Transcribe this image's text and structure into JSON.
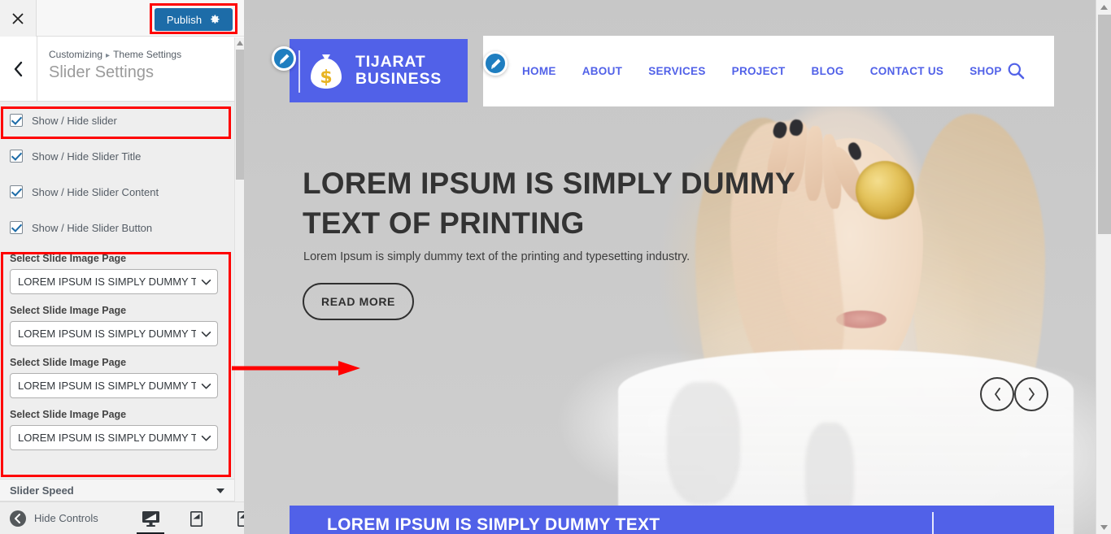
{
  "customizer": {
    "close_icon": "close-icon",
    "publish_label": "Publish",
    "publish_gear_icon": "gear-icon",
    "back_icon": "chevron-left-icon",
    "breadcrumb_root": "Customizing",
    "breadcrumb_separator": "▸",
    "breadcrumb_parent": "Theme Settings",
    "panel_title": "Slider Settings",
    "checkboxes": [
      {
        "label": "Show / Hide slider",
        "checked": true
      },
      {
        "label": "Show / Hide Slider Title",
        "checked": true
      },
      {
        "label": "Show / Hide Slider Content",
        "checked": true
      },
      {
        "label": "Show / Hide Slider Button",
        "checked": true
      }
    ],
    "selects": [
      {
        "label": "Select Slide Image Page",
        "value": "LOREM IPSUM IS SIMPLY DUMMY TE"
      },
      {
        "label": "Select Slide Image Page",
        "value": "LOREM IPSUM IS SIMPLY DUMMY TE"
      },
      {
        "label": "Select Slide Image Page",
        "value": "LOREM IPSUM IS SIMPLY DUMMY TE"
      },
      {
        "label": "Select Slide Image Page",
        "value": "LOREM IPSUM IS SIMPLY DUMMY TE"
      }
    ],
    "accordion": {
      "label": "Slider Speed",
      "caret_icon": "caret-down-icon"
    },
    "footer": {
      "hide_controls_label": "Hide Controls",
      "collapse_icon": "collapse-left-icon",
      "devices": [
        {
          "name": "desktop-preview",
          "icon": "desktop-icon",
          "active": true
        },
        {
          "name": "tablet-preview",
          "icon": "tablet-icon",
          "active": false
        },
        {
          "name": "mobile-preview",
          "icon": "mobile-icon",
          "active": false
        }
      ]
    },
    "annotations": {
      "accent_color": "#ff0000",
      "boxes": [
        "publish-button",
        "show-hide-slider-row",
        "select-slide-image-page-group"
      ],
      "arrow": "points-right-from-selects-group"
    }
  },
  "preview": {
    "edit_pins": [
      {
        "name": "edit-logo-pin",
        "icon": "pencil-icon"
      },
      {
        "name": "edit-menu-pin",
        "icon": "pencil-icon"
      }
    ],
    "logo": {
      "icon": "money-bag-icon",
      "line1": "TIJARAT",
      "line2": "BUSINESS",
      "background": "#5161e8"
    },
    "nav": {
      "items": [
        "HOME",
        "ABOUT",
        "SERVICES",
        "PROJECT",
        "BLOG",
        "CONTACT US",
        "SHOP"
      ],
      "search_icon": "search-icon",
      "link_color": "#5161e8"
    },
    "hero": {
      "heading": "LOREM IPSUM IS SIMPLY DUMMY TEXT OF PRINTING",
      "paragraph": "Lorem Ipsum is simply dummy text of the printing and typesetting industry.",
      "button_label": "READ MORE",
      "prev_icon": "chevron-left-icon",
      "next_icon": "chevron-right-icon"
    },
    "bottom_band": {
      "text": "LOREM IPSUM IS SIMPLY DUMMY TEXT",
      "background": "#5161e8"
    }
  }
}
